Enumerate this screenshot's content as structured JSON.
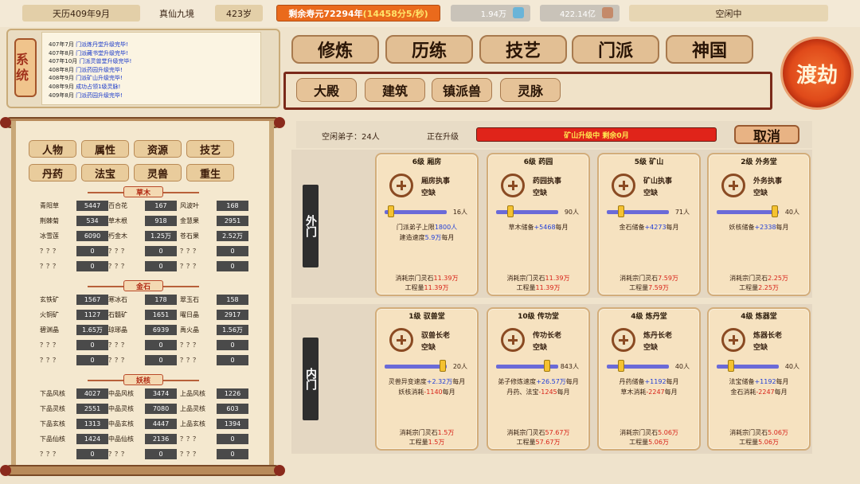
{
  "topbar": {
    "date": "天历409年9月",
    "realm": "真仙九境",
    "age": "423岁",
    "life_prefix": "剩余寿元72294年",
    "life_rate": "(14458分5/秒)",
    "res1": "1.94万",
    "res2": "422.14亿",
    "status": "空闲中"
  },
  "log": {
    "system_label": "系统",
    "entries": [
      {
        "date": "407年7月",
        "text": "门派炼丹堂升级完毕!"
      },
      {
        "date": "407年8月",
        "text": "门派藏书堂升级完毕!"
      },
      {
        "date": "407年10月",
        "text": "门派灵兽堂升级完毕!"
      },
      {
        "date": "408年8月",
        "text": "门派药园升级完毕!"
      },
      {
        "date": "408年9月",
        "text": "门派矿山升级完毕!"
      },
      {
        "date": "408年9月",
        "text": "成功占领1级灵脉!"
      },
      {
        "date": "409年8月",
        "text": "门派药园升级完毕!"
      }
    ]
  },
  "categories": [
    "人物",
    "属性",
    "资源",
    "技艺",
    "丹药",
    "法宝",
    "灵兽",
    "重生"
  ],
  "resources": {
    "sections": [
      {
        "title": "草木",
        "rows": [
          [
            [
              "青阳草",
              "5447"
            ],
            [
              "百合花",
              "167"
            ],
            [
              "风波叶",
              "168"
            ]
          ],
          [
            [
              "荆棘菊",
              "534"
            ],
            [
              "草木根",
              "918"
            ],
            [
              "金慧果",
              "2951"
            ]
          ],
          [
            [
              "冰雪莲",
              "6090"
            ],
            [
              "朽金木",
              "1.25万"
            ],
            [
              "苍石果",
              "2.52万"
            ]
          ],
          [
            [
              "？？？",
              "0"
            ],
            [
              "？？？",
              "0"
            ],
            [
              "？？？",
              "0"
            ]
          ],
          [
            [
              "？？？",
              "0"
            ],
            [
              "？？？",
              "0"
            ],
            [
              "？？？",
              "0"
            ]
          ]
        ]
      },
      {
        "title": "金石",
        "rows": [
          [
            [
              "玄铁矿",
              "1567"
            ],
            [
              "寒冰石",
              "178"
            ],
            [
              "翠玉石",
              "158"
            ]
          ],
          [
            [
              "火铜矿",
              "1127"
            ],
            [
              "石髓矿",
              "1651"
            ],
            [
              "曜日晶",
              "2917"
            ]
          ],
          [
            [
              "碧渊晶",
              "1.65万"
            ],
            [
              "琼琊晶",
              "6939"
            ],
            [
              "禹火晶",
              "1.56万"
            ]
          ],
          [
            [
              "？？？",
              "0"
            ],
            [
              "？？？",
              "0"
            ],
            [
              "？？？",
              "0"
            ]
          ],
          [
            [
              "？？？",
              "0"
            ],
            [
              "？？？",
              "0"
            ],
            [
              "？？？",
              "0"
            ]
          ]
        ]
      },
      {
        "title": "妖核",
        "rows": [
          [
            [
              "下品风核",
              "4027"
            ],
            [
              "中品风核",
              "3474"
            ],
            [
              "上品风核",
              "1226"
            ]
          ],
          [
            [
              "下品灵核",
              "2551"
            ],
            [
              "中品灵核",
              "7080"
            ],
            [
              "上品灵核",
              "603"
            ]
          ],
          [
            [
              "下品玄核",
              "1313"
            ],
            [
              "中品玄核",
              "4447"
            ],
            [
              "上品玄核",
              "1394"
            ]
          ],
          [
            [
              "下品仙核",
              "1424"
            ],
            [
              "中品仙核",
              "2136"
            ],
            [
              "？？？",
              "0"
            ]
          ],
          [
            [
              "？？？",
              "0"
            ],
            [
              "？？？",
              "0"
            ],
            [
              "？？？",
              "0"
            ]
          ]
        ]
      }
    ]
  },
  "nav": {
    "tabs": [
      "修炼",
      "历练",
      "技艺",
      "门派",
      "神国"
    ],
    "subtabs": [
      "大殿",
      "建筑",
      "镇派兽",
      "灵脉"
    ],
    "dujie": "渡劫"
  },
  "upgrade": {
    "idle_label": "空闲弟子：24人",
    "upgrading_label": "正在升级",
    "progress_text": "矿山升级中  剩余0月",
    "cancel": "取消"
  },
  "outer": {
    "label": "外门",
    "cards": [
      {
        "title": "6级 厢房",
        "role": "厢房执事",
        "vacancy": "空缺",
        "count": "16人",
        "fill": 0.05,
        "info1": [
          "门派弟子上限",
          {
            "t": "1800人",
            "c": "blue"
          }
        ],
        "info2": [
          "建造速度",
          {
            "t": "5.9万",
            "c": "blue"
          },
          "每月"
        ],
        "cost": "11.39万",
        "time": "11.39万"
      },
      {
        "title": "6级 药园",
        "role": "药园执事",
        "vacancy": "空缺",
        "count": "90人",
        "fill": 0.2,
        "info1": [
          "草木储备",
          {
            "t": "+5468",
            "c": "blue"
          },
          "每月"
        ],
        "info2": [],
        "cost": "11.39万",
        "time": "11.39万"
      },
      {
        "title": "5级 矿山",
        "role": "矿山执事",
        "vacancy": "空缺",
        "count": "71人",
        "fill": 0.2,
        "info1": [
          "金石储备",
          {
            "t": "+4273",
            "c": "blue"
          },
          "每月"
        ],
        "info2": [],
        "cost": "7.59万",
        "time": "7.59万"
      },
      {
        "title": "2级 外务堂",
        "role": "外务执事",
        "vacancy": "空缺",
        "count": "40人",
        "fill": 0.98,
        "info1": [
          "妖核储备",
          {
            "t": "+2338",
            "c": "blue"
          },
          "每月"
        ],
        "info2": [],
        "cost": "2.25万",
        "time": "2.25万"
      }
    ]
  },
  "inner": {
    "label": "内门",
    "cards": [
      {
        "title": "1级 驭兽堂",
        "role": "驭兽长老",
        "vacancy": "空缺",
        "count": "20人",
        "fill": 0.98,
        "info1": [
          "灵兽异变速度",
          {
            "t": "+2.32万",
            "c": "blue"
          },
          "每月"
        ],
        "info2": [
          "妖核消耗",
          {
            "t": "-1140",
            "c": "red"
          },
          "每月"
        ],
        "cost": "1.5万",
        "time": "1.5万"
      },
      {
        "title": "10级 传功堂",
        "role": "传功长老",
        "vacancy": "空缺",
        "count": "843人",
        "fill": 0.85,
        "info1": [
          "弟子修炼速度",
          {
            "t": "+26.57万",
            "c": "blue"
          },
          "每月"
        ],
        "info2": [
          "丹药、法宝",
          {
            "t": "-1245",
            "c": "red"
          },
          "每月"
        ],
        "cost": "57.67万",
        "time": "57.67万"
      },
      {
        "title": "4级 炼丹堂",
        "role": "炼丹长老",
        "vacancy": "空缺",
        "count": "40人",
        "fill": 0.2,
        "info1": [
          "丹药储备",
          {
            "t": "+1192",
            "c": "blue"
          },
          "每月"
        ],
        "info2": [
          "草木消耗",
          {
            "t": "-2247",
            "c": "red"
          },
          "每月"
        ],
        "cost": "5.06万",
        "time": "5.06万"
      },
      {
        "title": "4级 炼器堂",
        "role": "炼器长老",
        "vacancy": "空缺",
        "count": "40人",
        "fill": 0.2,
        "info1": [
          "法宝储备",
          {
            "t": "+1192",
            "c": "blue"
          },
          "每月"
        ],
        "info2": [
          "金石消耗",
          {
            "t": "-2247",
            "c": "red"
          },
          "每月"
        ],
        "cost": "5.06万",
        "time": "5.06万"
      }
    ]
  },
  "labels": {
    "cost_prefix": "消耗宗门灵石",
    "time_prefix": "工程量"
  },
  "colors": {
    "accent": "#ea6a1c",
    "danger": "#e0241a",
    "info": "#2340d8"
  }
}
